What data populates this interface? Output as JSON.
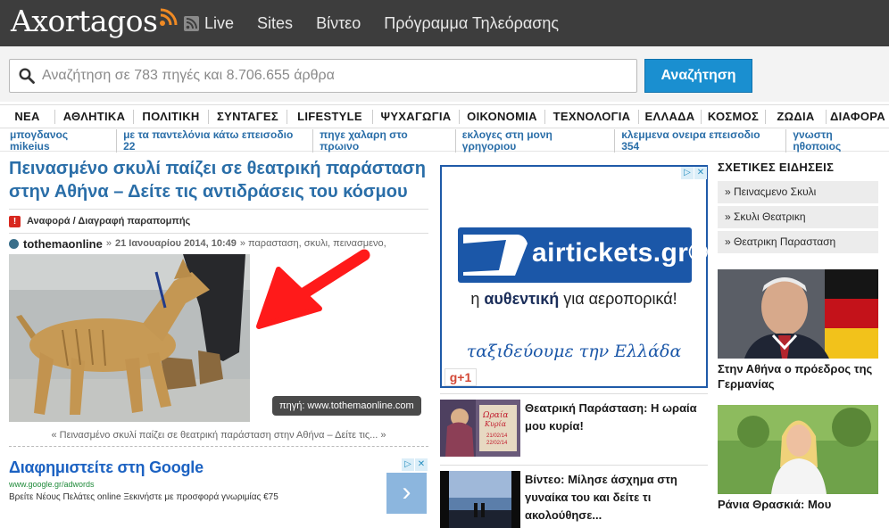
{
  "header": {
    "logo": "Axortagos",
    "nav": [
      {
        "label": "Live",
        "icon": "live-feed-icon"
      },
      {
        "label": "Sites"
      },
      {
        "label": "Βίντεο"
      },
      {
        "label": "Πρόγραμμα Τηλεόρασης"
      }
    ]
  },
  "search": {
    "placeholder": "Αναζήτηση σε 783 πηγές και 8.706.655 άρθρα",
    "button": "Αναζήτηση"
  },
  "categories": [
    "ΝΕΑ",
    "ΑΘΛΗΤΙΚΑ",
    "ΠΟΛΙΤΙΚΗ",
    "ΣΥΝΤΑΓΕΣ",
    "LIFESTYLE",
    "ΨΥΧΑΓΩΓΙΑ",
    "ΟΙΚΟΝΟΜΙΑ",
    "ΤΕΧΝΟΛΟΓΙΑ",
    "ΕΛΛΑΔΑ",
    "ΚΟΣΜΟΣ",
    "ΖΩΔΙΑ",
    "ΔΙΑΦΟΡΑ"
  ],
  "trending": [
    "μπογδανος mikeius",
    "με τα παντελόνια κάτω επεισοδιο 22",
    "πηγε χαλαρη στο πρωινο",
    "εκλογες στη μονη γρηγοριου",
    "κλεμμενα ονειρα επεισοδιο 354",
    "γνωστη ηθοποιος"
  ],
  "article": {
    "title": "Πεινασμένο σκυλί παίζει σε θεατρική παράσταση στην Αθήνα – Δείτε τις αντιδράσεις του κόσμου",
    "report": "Αναφορά / Διαγραφή παραπομπής",
    "source": "tothemaonline",
    "date": "21 Ιανουαρίου 2014, 10:49",
    "tags": "» παρασταση, σκυλι, πεινασμενο,",
    "credit": "πηγή: www.tothemaonline.com",
    "caption": "« Πεινασμένο σκυλί παίζει σε θεατρική παράσταση στην Αθήνα – Δείτε τις... »"
  },
  "google_ad": {
    "title": "Διαφημιστείτε στη Google",
    "url": "www.google.gr/adwords",
    "description": "Βρείτε Νέους Πελάτες online Ξεκινήστε με προσφορά γνωριμίας €75"
  },
  "banner": {
    "brand": "airtickets.gr®",
    "tagline_pre": "η ",
    "tagline_bold": "αυθεντική",
    "tagline_post": " για αεροπορικά!",
    "slogan": "ταξιδεύουμε την Ελλάδα",
    "gplus": "g+1"
  },
  "mid_items": [
    {
      "title": "Θεατρική Παράσταση: Η ωραία μου κυρία!"
    },
    {
      "title": "Βίντεο: Μίλησε άσχημα στη γυναίκα του και δείτε τι ακολούθησε..."
    }
  ],
  "related": {
    "heading": "ΣΧΕΤΙΚΕΣ ΕΙΔΗΣΕΙΣ",
    "items": [
      "» Πειναςμενο Σκυλι",
      "» Σκυλι Θεατρικη",
      "» Θεατρικη Παρασταση"
    ],
    "stories": [
      {
        "caption": "Στην Αθήνα ο πρόεδρος της Γερμανίας"
      },
      {
        "caption": "Ράνια Θρασκιά: Μου"
      }
    ]
  },
  "colors": {
    "accent": "#2a6ea8",
    "search_button": "#1a8fd0",
    "topbar": "#3d3d3d",
    "banner": "#1b57a8"
  }
}
